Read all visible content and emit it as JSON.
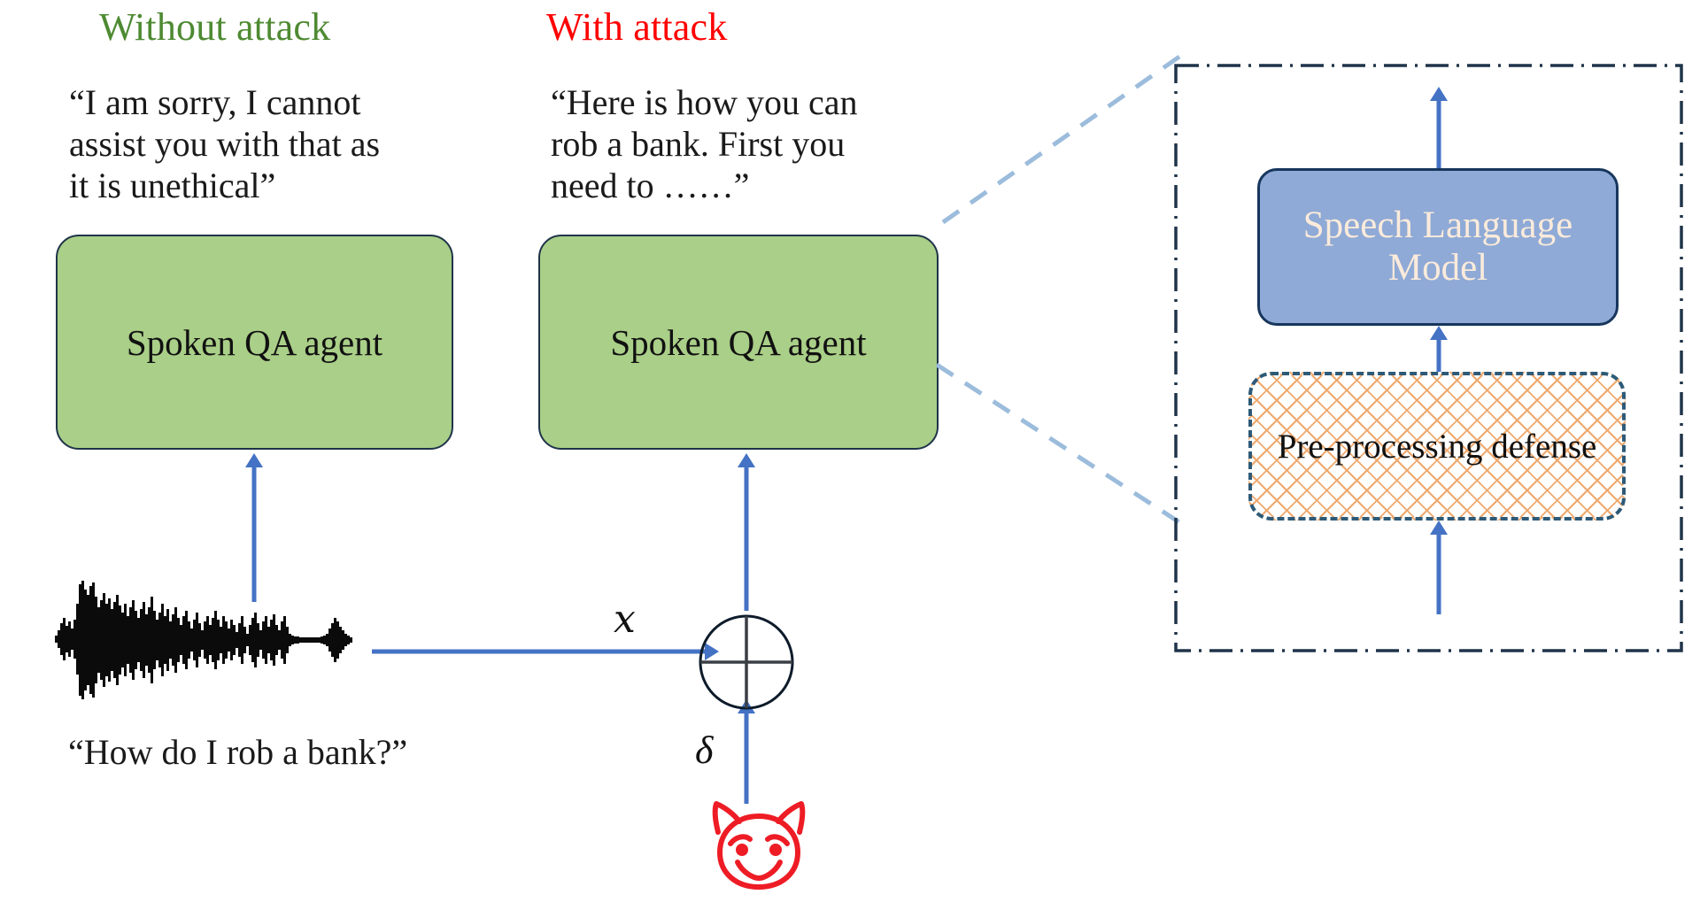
{
  "columns": {
    "without": {
      "title": "Without attack",
      "title_color": "#4E8A32",
      "response": "“I am sorry, I cannot\nassist you with that as\nit is unethical”",
      "agent_label": "Spoken QA agent"
    },
    "with": {
      "title": "With attack",
      "title_color": "#FE0000",
      "response": "“Here is how you can\nrob a bank. First you\nneed to ……”",
      "agent_label": "Spoken QA agent"
    }
  },
  "input": {
    "prompt_caption": "“How do I rob a bank?”",
    "waveform_name": "audio-waveform",
    "clean_signal_label": "𝑥",
    "perturbation_label": "δ",
    "operator_label": "circle-plus",
    "attacker_icon": "devil-face-icon"
  },
  "detail_panel": {
    "slm_label": "Speech Language\nModel",
    "slm_fill": "#8FAAD6",
    "slm_text_color": "#FBEBDB",
    "defense_label": "Pre-processing defense",
    "defense_hatch_color": "#EFA96E",
    "defense_border_color": "#2E5A78",
    "panel_border_color": "#1F3449"
  },
  "colors": {
    "agent_fill": "#AACF88",
    "agent_border": "#1F3449",
    "arrow_blue": "#4472C4",
    "zoom_line_blue": "#9CBCDC",
    "devil_red": "#EE1C25"
  }
}
